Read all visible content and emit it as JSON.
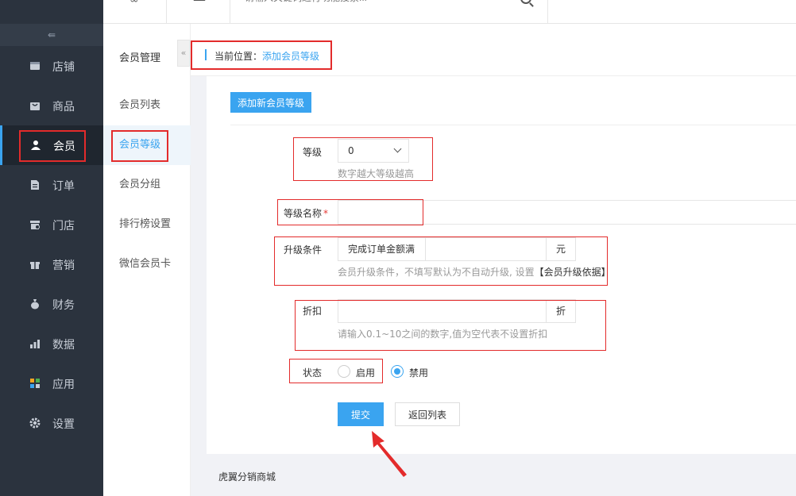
{
  "topbar": {
    "search_placeholder": "请输入关键词进行功能搜索..."
  },
  "sidebar": {
    "collapse_glyph": "⇚",
    "items": [
      {
        "label": "店铺",
        "icon": "store-icon"
      },
      {
        "label": "商品",
        "icon": "bag-icon"
      },
      {
        "label": "会员",
        "icon": "user-icon"
      },
      {
        "label": "订单",
        "icon": "order-icon"
      },
      {
        "label": "门店",
        "icon": "shop-icon"
      },
      {
        "label": "营销",
        "icon": "gift-icon"
      },
      {
        "label": "财务",
        "icon": "money-bag-icon"
      },
      {
        "label": "数据",
        "icon": "chart-icon"
      },
      {
        "label": "应用",
        "icon": "apps-icon"
      },
      {
        "label": "设置",
        "icon": "gear-icon"
      }
    ]
  },
  "subnav": {
    "title": "会员管理",
    "items": [
      "会员列表",
      "会员等级",
      "会员分组",
      "排行榜设置",
      "微信会员卡"
    ]
  },
  "breadcrumb": {
    "label": "当前位置：",
    "current": "添加会员等级"
  },
  "form": {
    "add_button": "添加新会员等级",
    "level": {
      "label": "等级",
      "value": "0",
      "hint": "数字越大等级越高"
    },
    "name": {
      "label": "等级名称",
      "required_mark": "*"
    },
    "upgrade": {
      "label": "升级条件",
      "prefix": "完成订单金额满",
      "suffix": "元",
      "hint": "会员升级条件，不填写默认为不自动升级, 设置",
      "hint_link": "【会员升级依据】"
    },
    "discount": {
      "label": "折扣",
      "suffix": "折",
      "hint": "请输入0.1~10之间的数字,值为空代表不设置折扣"
    },
    "status": {
      "label": "状态",
      "options": [
        "启用",
        "禁用"
      ],
      "selected": "禁用"
    },
    "submit": "提交",
    "back": "返回列表"
  },
  "footer": "虎翼分销商城",
  "colors": {
    "accent": "#3aa4f0",
    "sidebar_bg": "#2b333e",
    "annotation": "#e32b2b"
  }
}
